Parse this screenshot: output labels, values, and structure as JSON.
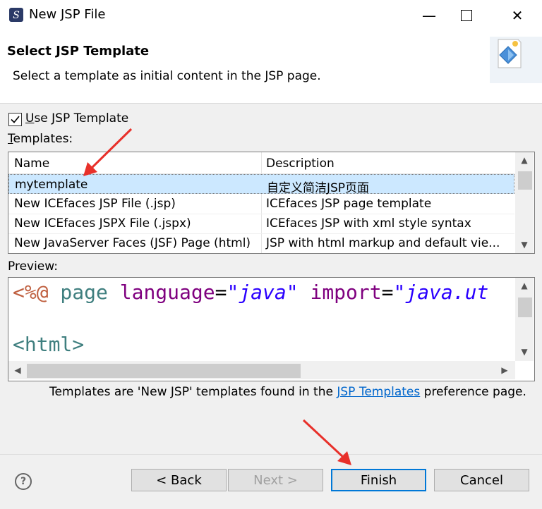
{
  "window": {
    "title": "New JSP File"
  },
  "header": {
    "title": "Select JSP Template",
    "description": "Select a template as initial content in the JSP page."
  },
  "use_template": {
    "label_prefix": "U",
    "label_rest": "se JSP Template",
    "checked": true
  },
  "templates": {
    "label_prefix": "T",
    "label_rest": "emplates:",
    "columns": [
      "Name",
      "Description"
    ],
    "rows": [
      {
        "name": "mytemplate",
        "description": "自定义简洁JSP页面",
        "selected": true
      },
      {
        "name": "New ICEfaces JSP File (.jsp)",
        "description": "ICEfaces JSP page template"
      },
      {
        "name": "New ICEfaces JSPX File (.jspx)",
        "description": "ICEfaces JSP with xml style syntax"
      },
      {
        "name": "New JavaServer Faces (JSF) Page (html)",
        "description": "JSP with html markup and default vie..."
      }
    ]
  },
  "preview": {
    "label": "Preview:",
    "line1": {
      "a": "<%@",
      "b": " page ",
      "c": "language",
      "d": "=",
      "e": "\"java\"",
      "f": " import",
      "g": "=",
      "h": "\"java.ut"
    },
    "line2": "<html>"
  },
  "footer": {
    "note_before": "Templates are 'New JSP' templates found in the ",
    "link": "JSP Templates",
    "note_after": " preference page."
  },
  "buttons": {
    "back": "< Back",
    "next": "Next >",
    "finish": "Finish",
    "cancel": "Cancel"
  },
  "icons": [
    "app-icon",
    "minimize-icon",
    "maximize-icon",
    "close-icon",
    "wizard-banner-icon",
    "help-icon"
  ],
  "colors": {
    "selection": "#cce8ff",
    "link": "#0066cc",
    "arrow": "#e8302a"
  }
}
